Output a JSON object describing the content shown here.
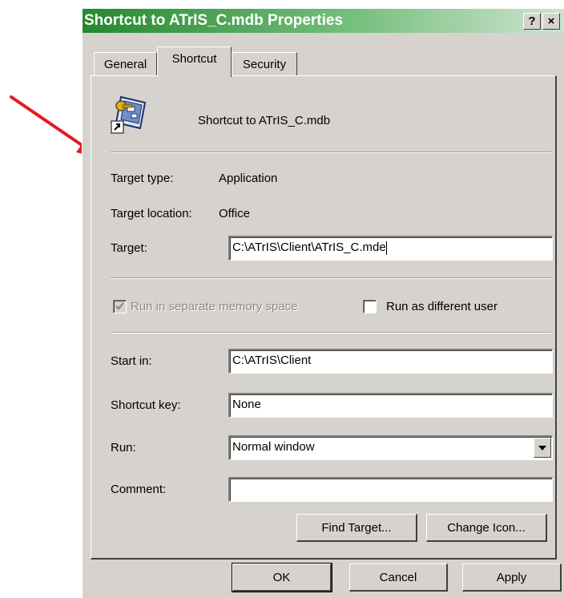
{
  "window": {
    "title": "Shortcut to ATrIS_C.mdb Properties",
    "help_button": "?",
    "close_button": "×"
  },
  "tabs": [
    "General",
    "Shortcut",
    "Security"
  ],
  "active_tab": "Shortcut",
  "shortcut": {
    "name": "Shortcut to ATrIS_C.mdb",
    "target_type_label": "Target type:",
    "target_type_value": "Application",
    "target_location_label": "Target location:",
    "target_location_value": "Office",
    "target_label": "Target:",
    "target_value": "C:\\ATrIS\\Client\\ATrIS_C.mde",
    "run_separate_memory_label": "Run in separate memory space",
    "run_separate_memory_checked": true,
    "run_separate_memory_enabled": false,
    "run_as_different_user_label": "Run as different user",
    "run_as_different_user_checked": false,
    "start_in_label": "Start in:",
    "start_in_value": "C:\\ATrIS\\Client",
    "shortcut_key_label": "Shortcut key:",
    "shortcut_key_value": "None",
    "run_label": "Run:",
    "run_value": "Normal window",
    "comment_label": "Comment:",
    "comment_value": "",
    "find_target_button": "Find Target...",
    "change_icon_button": "Change Icon..."
  },
  "footer": {
    "ok_button": "OK",
    "cancel_button": "Cancel",
    "apply_button": "Apply"
  },
  "icons": {
    "shortcut_file": "access-database-shortcut-icon",
    "dropdown": "chevron-down-icon",
    "annotation": "red-arrow-icon"
  },
  "colors": {
    "title_bar_start": "#25882f",
    "title_bar_end": "#cfe3d0",
    "dialog_face": "#d6d3ce",
    "annotation_arrow": "#e11b22"
  }
}
